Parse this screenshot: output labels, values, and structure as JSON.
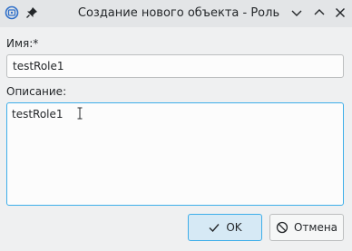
{
  "window": {
    "title": "Создание нового объекта - Роль",
    "icons": {
      "app": "app-logo-icon",
      "pin": "pin-icon",
      "minimize": "chevron-down-icon",
      "maximize": "chevron-up-icon",
      "close": "close-icon"
    }
  },
  "form": {
    "name_label": "Имя:*",
    "name_value": "testRole1",
    "description_label": "Описание:",
    "description_value": "testRole1"
  },
  "buttons": {
    "ok_label": "OK",
    "cancel_label": "Отмена"
  },
  "colors": {
    "accent": "#3daee9",
    "ok_background": "#d6e9f5",
    "window_background": "#eff0f1"
  }
}
